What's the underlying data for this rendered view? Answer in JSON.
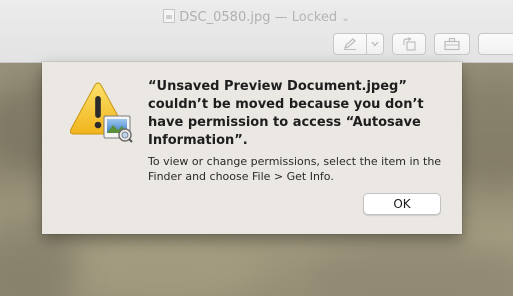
{
  "window": {
    "title": "DSC_0580.jpg",
    "separator": " — ",
    "status": "Locked",
    "status_chevron": "⌄"
  },
  "toolbar": {
    "buttons": [
      {
        "icon": "pen-icon"
      },
      {
        "icon": "chevron-down-icon"
      },
      {
        "icon": "rotate-icon"
      },
      {
        "icon": "toolbox-icon"
      },
      {
        "icon": "search-icon"
      }
    ]
  },
  "alert": {
    "icon": "warning-icon",
    "heading": "“Unsaved Preview Document.jpeg” couldn’t be moved because you don’t have permission to access “Autosave Information”.",
    "informative_text": "To view or change permissions, select the item in the Finder and choose File > Get Info.",
    "ok_label": "OK"
  },
  "colors": {
    "sheet_background": "#ebe8e3",
    "toolbar_background": "#ececec",
    "warning_yellow": "#f3c623",
    "backdrop": "#968e75"
  }
}
